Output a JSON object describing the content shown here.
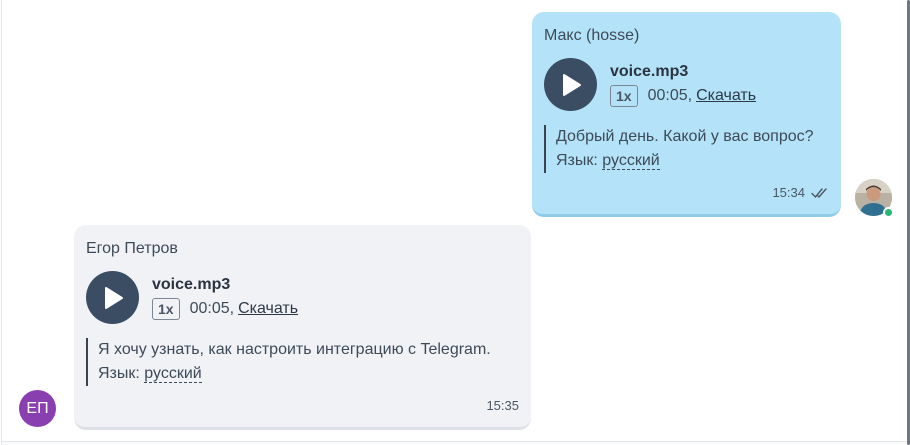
{
  "messages": [
    {
      "direction": "outgoing",
      "sender": "Макс (hosse)",
      "file_name": "voice.mp3",
      "speed": "1x",
      "duration": "00:05,",
      "download_label": "Скачать",
      "transcript_text": "Добрый день. Какой у вас вопрос?",
      "language_label": "Язык:",
      "language_value": "русский",
      "time": "15:34",
      "status_icon": "double-check-icon"
    },
    {
      "direction": "incoming",
      "sender": "Егор Петров",
      "file_name": "voice.mp3",
      "speed": "1x",
      "duration": "00:05,",
      "download_label": "Скачать",
      "transcript_text": "Я хочу узнать, как настроить интеграцию с Telegram.",
      "language_label": "Язык:",
      "language_value": "русский",
      "time": "15:35"
    }
  ],
  "avatars": {
    "agent_online_color": "#2bb673",
    "customer_initials": "ЕП",
    "customer_color": "#8a3fb1"
  },
  "colors": {
    "outgoing_bubble": "#b4e3f9",
    "incoming_bubble": "#f1f2f6",
    "play_button": "#3a4d63"
  }
}
